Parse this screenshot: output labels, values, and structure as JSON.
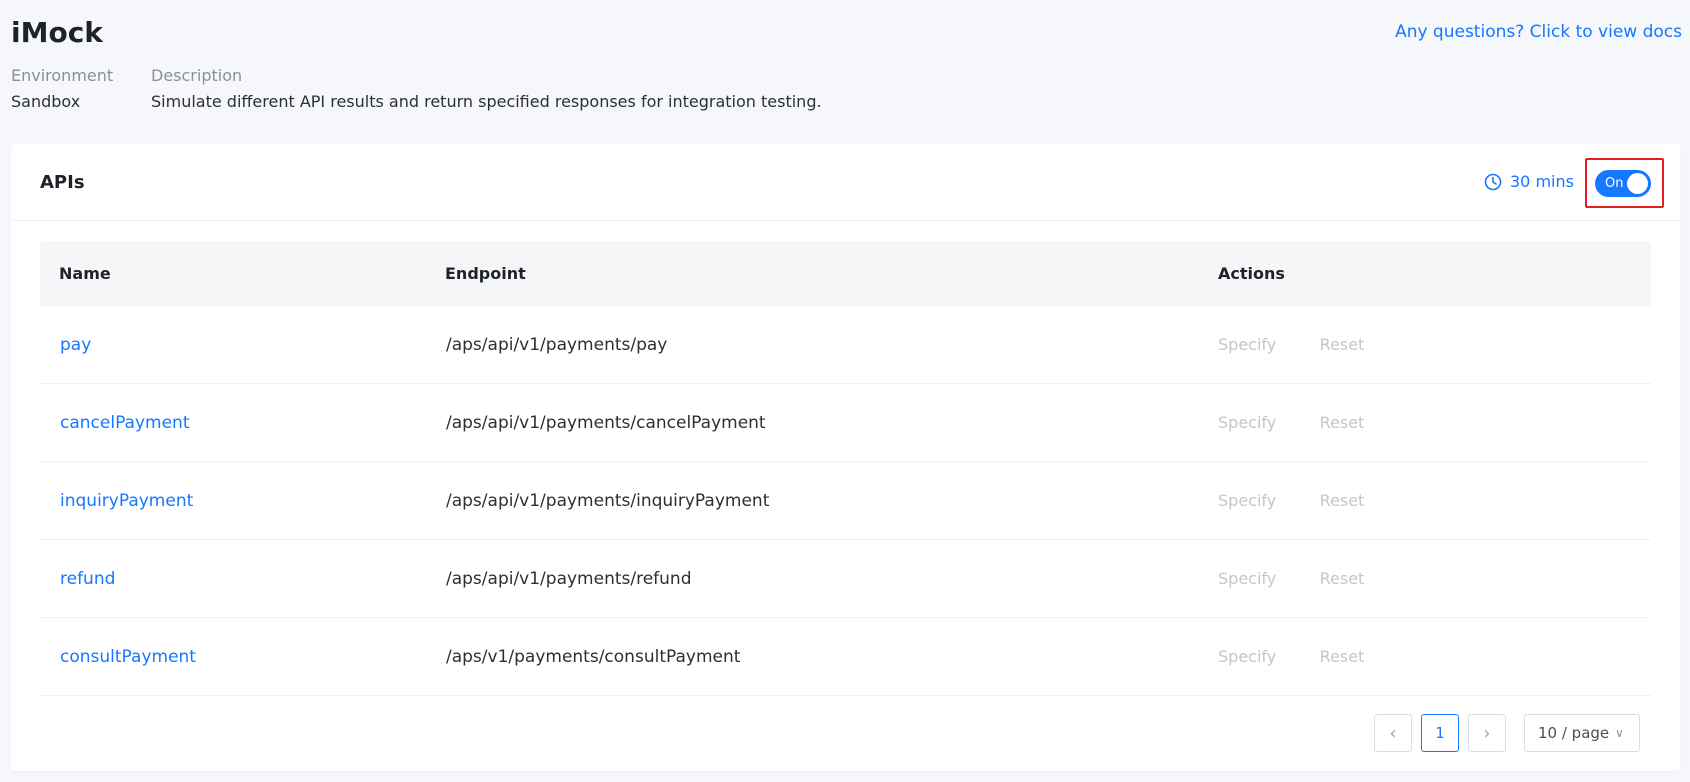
{
  "header": {
    "title": "iMock",
    "docs_link": "Any questions? Click to view docs",
    "environment_label": "Environment",
    "environment_value": "Sandbox",
    "description_label": "Description",
    "description_value": "Simulate different API results and return specified responses for integration testing."
  },
  "card": {
    "title": "APIs",
    "timer": "30 mins",
    "toggle_label": "On",
    "toggle_state": "on",
    "accent_color": "#1677ff",
    "highlight_color": "#e02020"
  },
  "table": {
    "columns": [
      "Name",
      "Endpoint",
      "Actions"
    ],
    "rows": [
      {
        "name": "pay",
        "endpoint": "/aps/api/v1/payments/pay"
      },
      {
        "name": "cancelPayment",
        "endpoint": "/aps/api/v1/payments/cancelPayment"
      },
      {
        "name": "inquiryPayment",
        "endpoint": "/aps/api/v1/payments/inquiryPayment"
      },
      {
        "name": "refund",
        "endpoint": "/aps/api/v1/payments/refund"
      },
      {
        "name": "consultPayment",
        "endpoint": "/aps/v1/payments/consultPayment"
      }
    ],
    "action_specify": "Specify",
    "action_reset": "Reset"
  },
  "pagination": {
    "prev_icon": "chevron-left-icon",
    "next_icon": "chevron-right-icon",
    "current_page": "1",
    "page_size": "10 / page"
  }
}
